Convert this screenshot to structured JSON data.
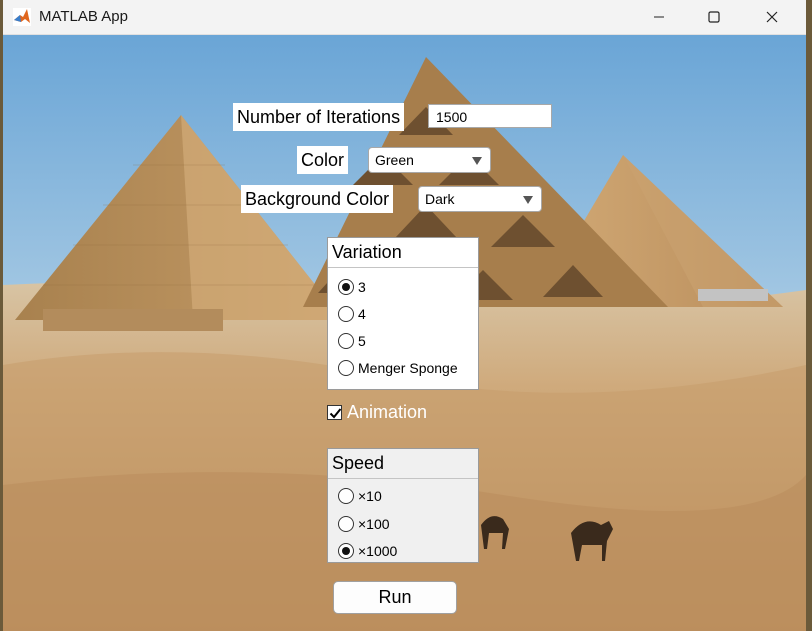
{
  "window": {
    "title": "MATLAB App",
    "controls": [
      "minimize-icon",
      "maximize-icon",
      "close-icon"
    ]
  },
  "iterations": {
    "label": "Number of Iterations",
    "value": "1500"
  },
  "color": {
    "label": "Color",
    "selected": "Green"
  },
  "background_color": {
    "label": "Background Color",
    "selected": "Dark"
  },
  "variation": {
    "title": "Variation",
    "options": [
      {
        "label": "3",
        "selected": true
      },
      {
        "label": "4",
        "selected": false
      },
      {
        "label": "5",
        "selected": false
      },
      {
        "label": "Menger Sponge",
        "selected": false
      }
    ]
  },
  "animation": {
    "label": "Animation",
    "checked": true
  },
  "speed": {
    "title": "Speed",
    "options": [
      {
        "label": "×10",
        "selected": false
      },
      {
        "label": "×100",
        "selected": false
      },
      {
        "label": "×1000",
        "selected": true
      }
    ]
  },
  "run": {
    "label": "Run"
  },
  "colors": {
    "sky": "#7fb4dc",
    "sand": "#c9a274",
    "pyramid": "#b18a5a"
  }
}
